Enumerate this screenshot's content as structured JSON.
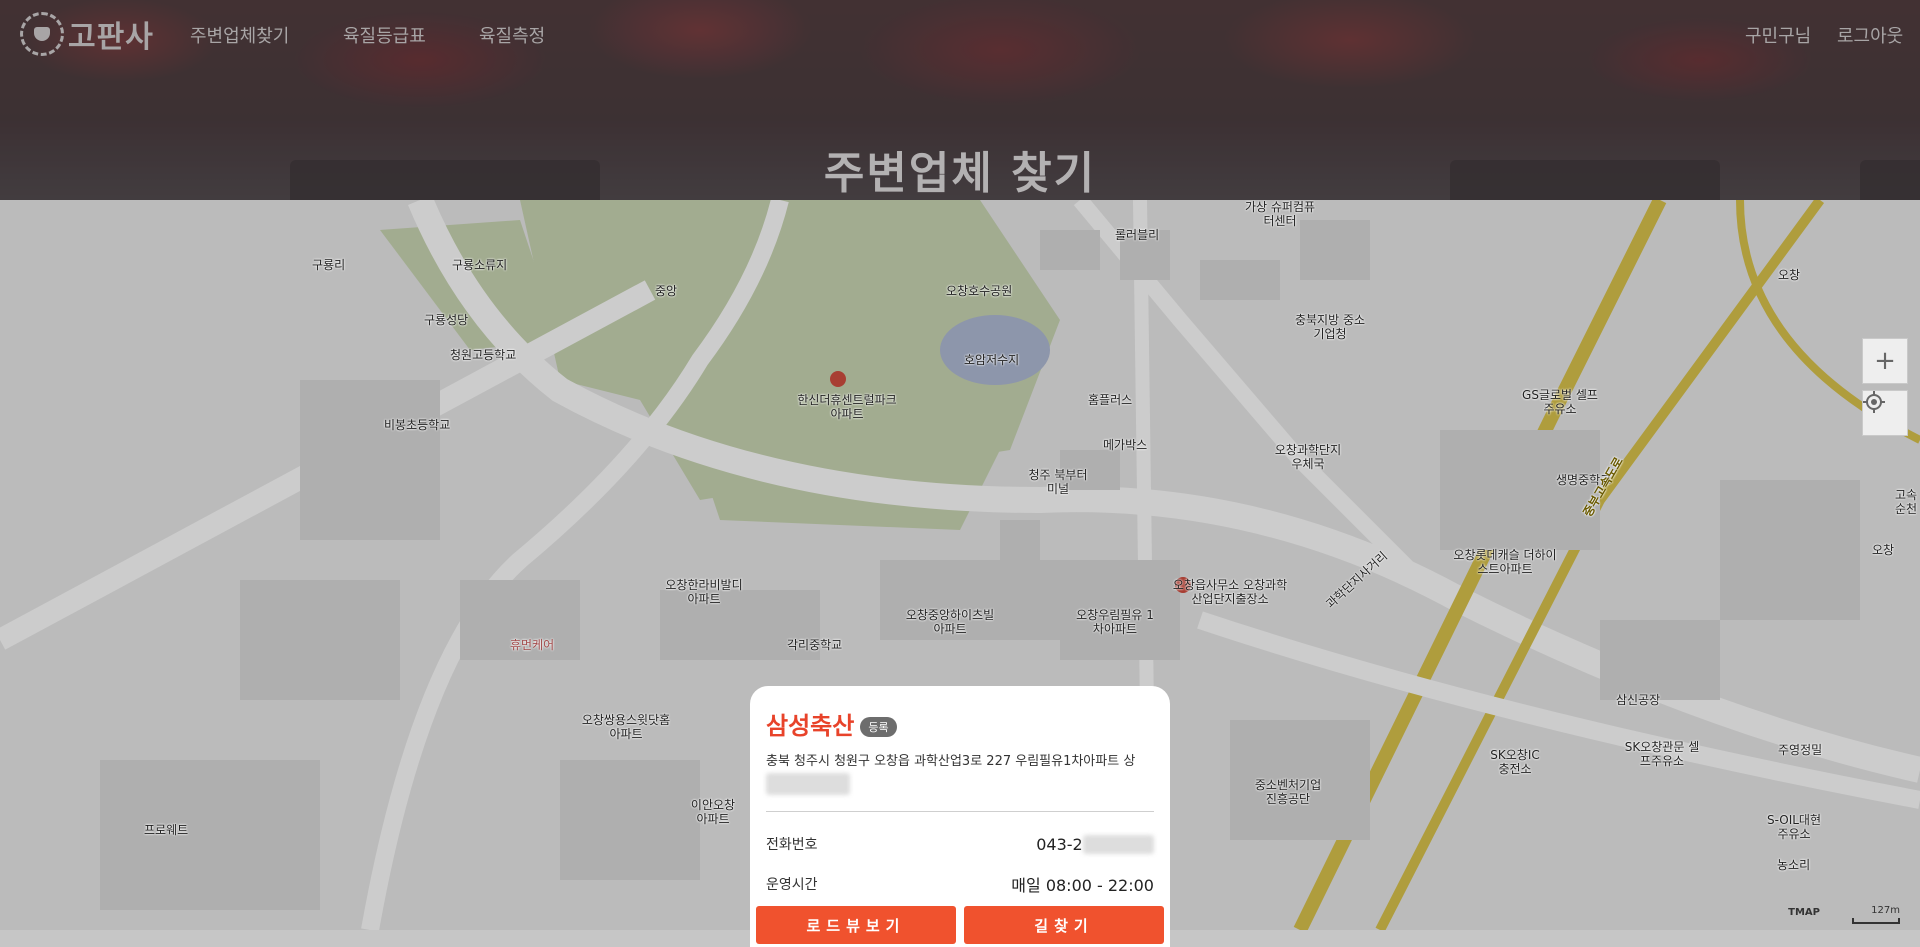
{
  "header": {
    "logo_text": "고판사",
    "nav": [
      "주변업체찾기",
      "육질등급표",
      "육질측정"
    ],
    "user_links": [
      "구민구님",
      "로그아웃"
    ],
    "page_title": "주변업체 찾기"
  },
  "map": {
    "labels": [
      "구룡리",
      "구룡소류지",
      "구룡성당",
      "청원고등학교",
      "비봉초등학교",
      "중앙",
      "오창호수공원",
      "호암저수지",
      "한신더휴센트럴파크 아파트",
      "롤러블리",
      "가상 슈퍼컴퓨터센터",
      "충북지방 중소기업청",
      "홈플러스",
      "메가박스",
      "청주 북부터미널",
      "오창과학단지 우체국",
      "GS글로벌 셀프주유소",
      "생명중학교",
      "오창",
      "오창롯데캐슬 더하이스트아파트",
      "오창읍사무소 오창과학산업단지출장소",
      "오창우림필유 1차아파트",
      "오창중앙하이츠빌 아파트",
      "오창한라비발디 아파트",
      "각리중학교",
      "휴먼케어",
      "오창쌍용스윗닷홈 아파트",
      "이안오창 아파트",
      "프로웨트",
      "중소벤처기업 진흥공단",
      "삼신공장",
      "SK오창IC 충전소",
      "SK오창관문 셀프주유소",
      "주영정밀",
      "S-OIL대현 주유소",
      "농소리",
      "고속 순천",
      "오창",
      "과학단지사거리",
      "중부고속도로"
    ],
    "zoom_in": "+",
    "locate_icon": "target-icon",
    "brand": "TMAP",
    "scale": "127m"
  },
  "place": {
    "name": "삼성축산",
    "badge": "등록",
    "address": "충북 청주시 청원구 오창읍 과학산업3로 227 우림필유1차아파트 상",
    "phone_label": "전화번호",
    "phone_value": "043-2",
    "hours_label": "운영시간",
    "hours_value": "매일 08:00 - 22:00",
    "btn_roadview": "로드뷰보기",
    "btn_directions": "길찾기"
  },
  "colors": {
    "accent": "#f0522e",
    "title_red": "#e8432a"
  }
}
